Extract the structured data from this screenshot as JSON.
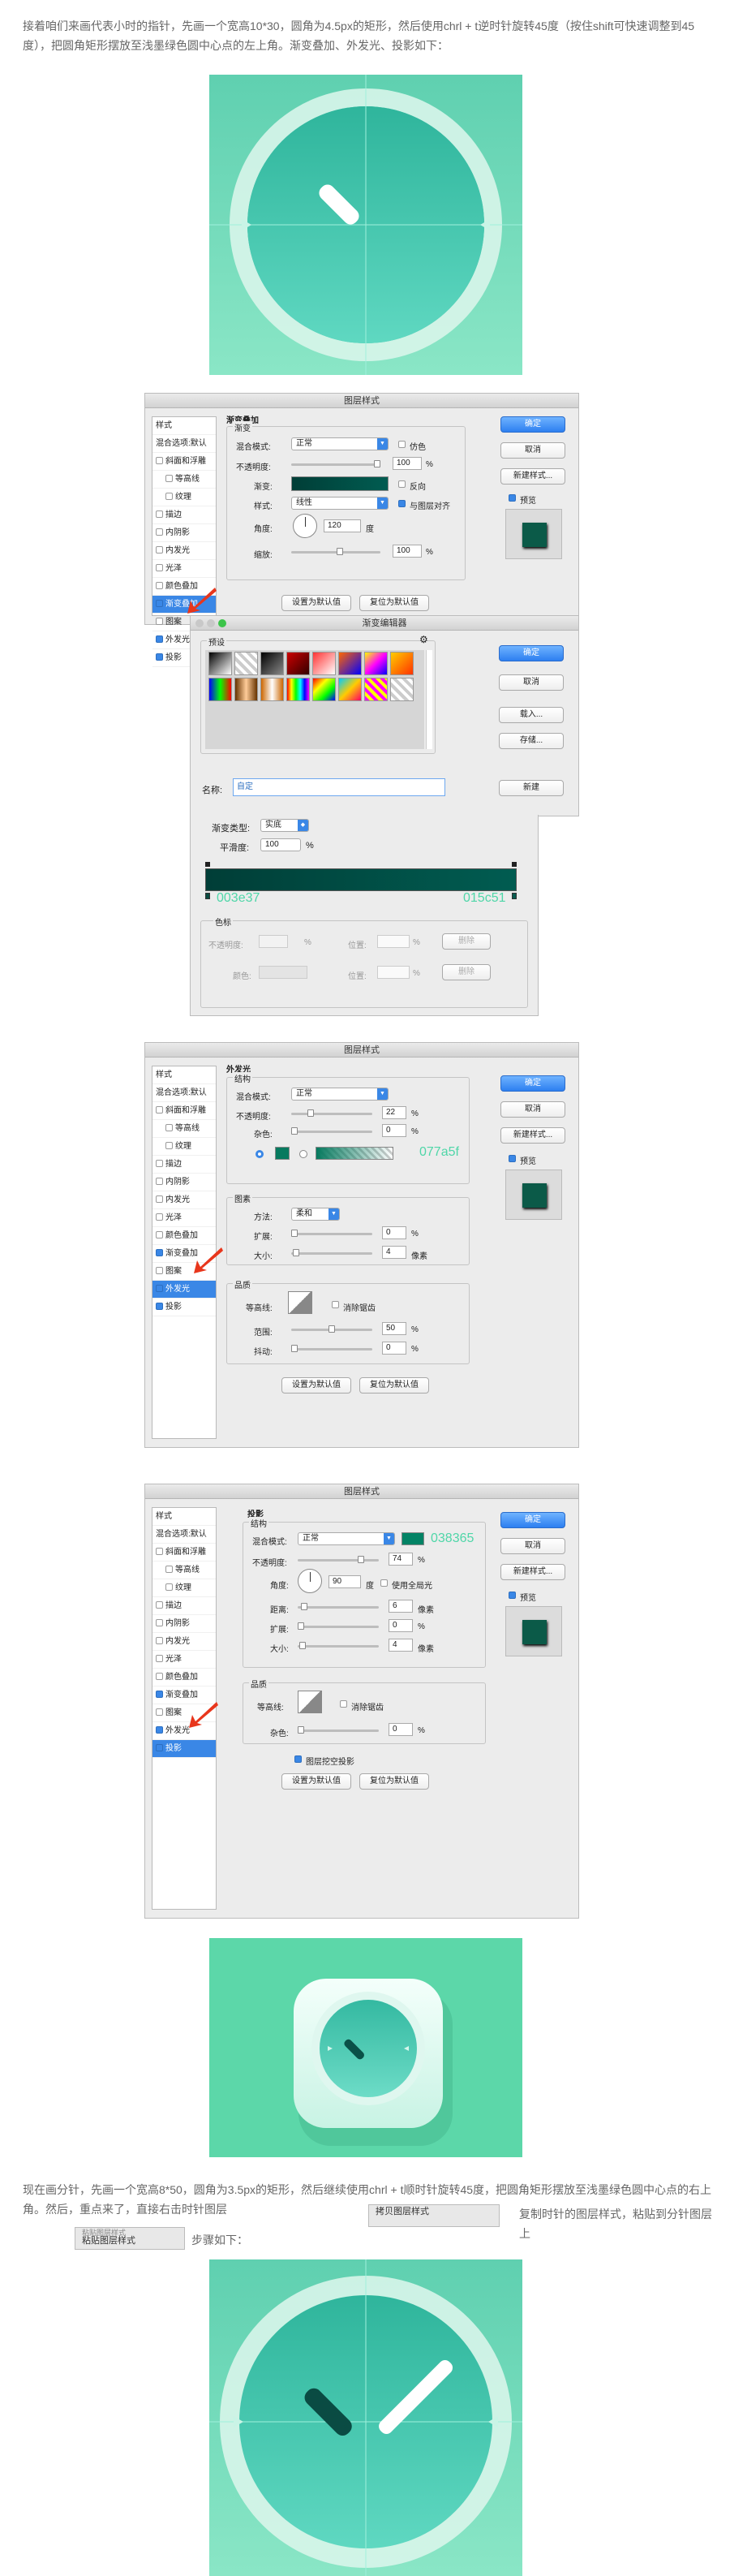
{
  "para1": "接着咱们来画代表小时的指针，先画一个宽高10*30，圆角为4.5px的矩形，然后使用chrl + t逆时针旋转45度（按住shift可快速调整到45度），把圆角矩形摆放至浅墨绿色圆中心点的左上角。渐变叠加、外发光、投影如下：",
  "dlg1": {
    "title": "图层样式",
    "sidebar": [
      "样式",
      "混合选项:默认",
      "斜面和浮雕",
      "等高线",
      "纹理",
      "描边",
      "内阴影",
      "内发光",
      "光泽",
      "颜色叠加",
      "渐变叠加",
      "图案",
      "外发光",
      "投影"
    ],
    "section": "渐变叠加",
    "sub": "渐变",
    "blend_label": "混合模式:",
    "blend_value": "正常",
    "dither": "仿色",
    "opacity_label": "不透明度:",
    "opacity_value": "100",
    "percent": "%",
    "gradient_label": "渐变:",
    "reverse": "反向",
    "style_label": "样式:",
    "style_value": "线性",
    "align": "与图层对齐",
    "angle_label": "角度:",
    "angle_value": "120",
    "deg": "度",
    "scale_label": "缩放:",
    "scale_value": "100",
    "set_default": "设置为默认值",
    "reset_default": "复位为默认值",
    "ok": "确定",
    "cancel": "取消",
    "new_style": "新建样式...",
    "preview": "预览"
  },
  "grad_editor": {
    "title": "渐变编辑器",
    "presets": "预设",
    "ok": "确定",
    "cancel": "取消",
    "load": "载入...",
    "save": "存储...",
    "name_label": "名称:",
    "name_value": "自定",
    "new": "新建",
    "type_label": "渐变类型:",
    "type_value": "实底",
    "smooth_label": "平滑度:",
    "smooth_value": "100",
    "percent": "%",
    "color_left": "003e37",
    "color_right": "015c51",
    "stops_label": "色标",
    "opacity_label": "不透明度:",
    "color_label": "颜色:",
    "position_label": "位置:",
    "delete": "删除"
  },
  "dlg2": {
    "title": "图层样式",
    "section": "外发光",
    "sub": "结构",
    "blend_label": "混合模式:",
    "blend_value": "正常",
    "opacity_label": "不透明度:",
    "opacity_value": "22",
    "noise_label": "杂色:",
    "noise_value": "0",
    "color_hex": "077a5f",
    "elements": "图素",
    "method_label": "方法:",
    "method_value": "柔和",
    "spread_label": "扩展:",
    "spread_value": "0",
    "size_label": "大小:",
    "size_value": "4",
    "px": "像素",
    "quality": "品质",
    "contour_label": "等高线:",
    "antialias": "消除锯齿",
    "range_label": "范围:",
    "range_value": "50",
    "jitter_label": "抖动:",
    "jitter_value": "0",
    "percent": "%"
  },
  "dlg3": {
    "title": "图层样式",
    "section": "投影",
    "sub": "结构",
    "blend_label": "混合模式:",
    "blend_value": "正常",
    "color_hex": "038365",
    "opacity_label": "不透明度:",
    "opacity_value": "74",
    "angle_label": "角度:",
    "angle_value": "90",
    "deg": "度",
    "global": "使用全局光",
    "distance_label": "距离:",
    "distance_value": "6",
    "spread_label": "扩展:",
    "spread_value": "0",
    "size_label": "大小:",
    "size_value": "4",
    "px": "像素",
    "quality": "品质",
    "contour_label": "等高线:",
    "antialias": "消除锯齿",
    "noise_label": "杂色:",
    "noise_value": "0",
    "knockout": "图层挖空投影",
    "percent": "%"
  },
  "para2_a": "现在画分针，先画一个宽高8*50，圆角为3.5px的矩形，然后继续使用chrl + t顺时针旋转45度，把圆角矩形摆放至浅墨绿色圆中心点的右上角。然后，重点来了，直接右击时针图层",
  "para2_b": "复制时针的图层样式，粘贴到分针图层上",
  "para2_c": "步骤如下：",
  "menu_copy": "拷贝图层样式",
  "menu_paste": "粘贴图层样式",
  "menu_paste_top": "粘贴图层样式"
}
